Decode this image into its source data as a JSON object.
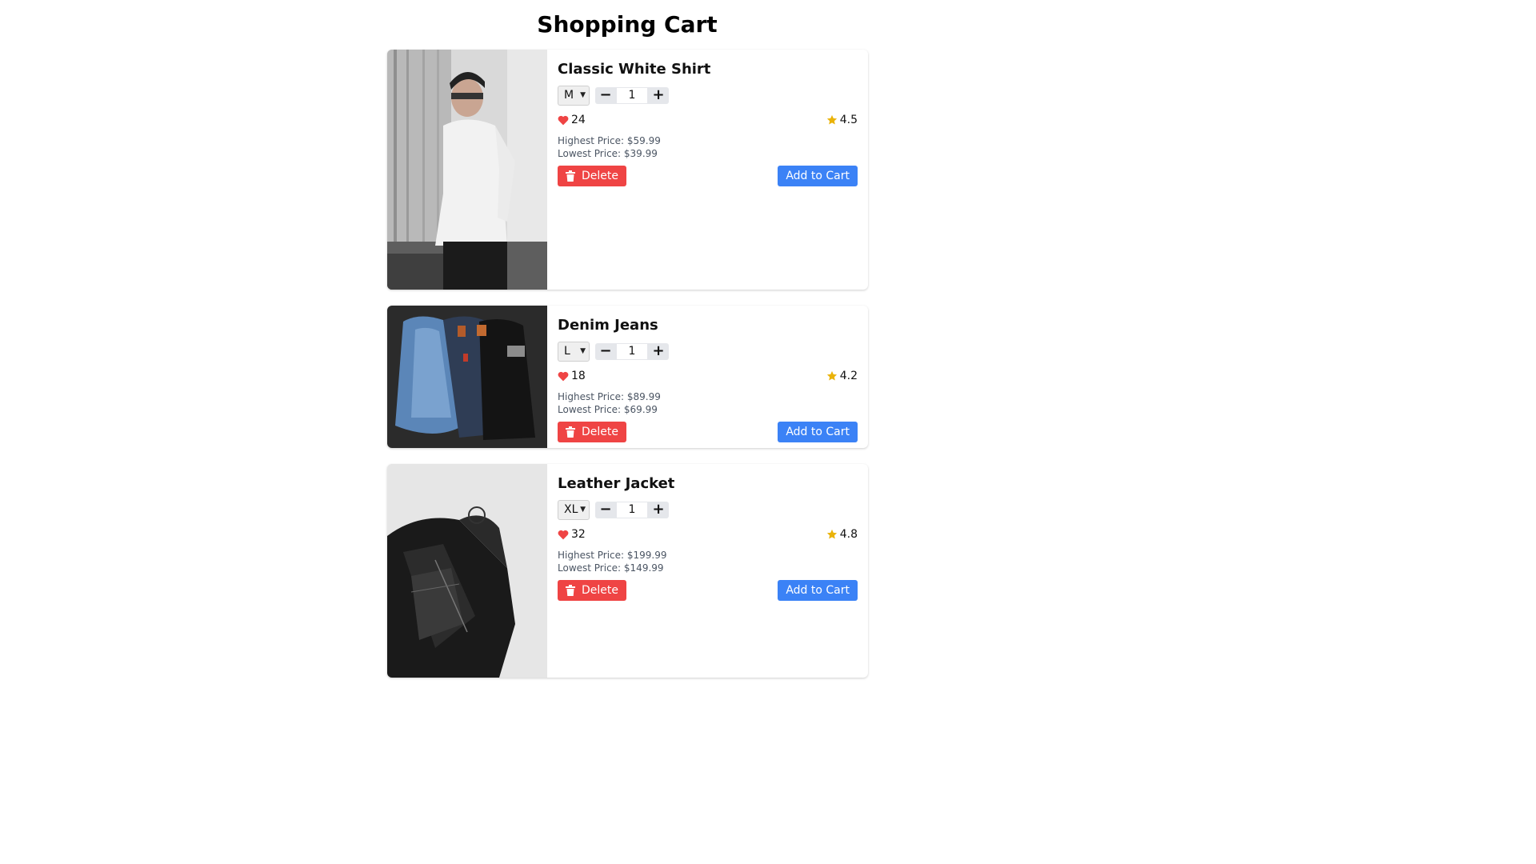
{
  "page": {
    "title": "Shopping Cart"
  },
  "colors": {
    "delete": "#ef4444",
    "add_to_cart": "#3b82f6",
    "heart": "#ef4444",
    "star": "#eab308"
  },
  "items": [
    {
      "name": "Classic White Shirt",
      "size": "M",
      "quantity": "1",
      "likes": "24",
      "rating": "4.5",
      "highest_price": "Highest Price: $59.99",
      "lowest_price": "Lowest Price: $39.99",
      "delete_label": "Delete",
      "add_label": "Add to Cart",
      "image_icon": "man-in-white-shirt-photo"
    },
    {
      "name": "Denim Jeans",
      "size": "L",
      "quantity": "1",
      "likes": "18",
      "rating": "4.2",
      "highest_price": "Highest Price: $89.99",
      "lowest_price": "Lowest Price: $69.99",
      "delete_label": "Delete",
      "add_label": "Add to Cart",
      "image_icon": "folded-jeans-photo"
    },
    {
      "name": "Leather Jacket",
      "size": "XL",
      "quantity": "1",
      "likes": "32",
      "rating": "4.8",
      "highest_price": "Highest Price: $199.99",
      "lowest_price": "Lowest Price: $149.99",
      "delete_label": "Delete",
      "add_label": "Add to Cart",
      "image_icon": "leather-jacket-photo"
    }
  ]
}
